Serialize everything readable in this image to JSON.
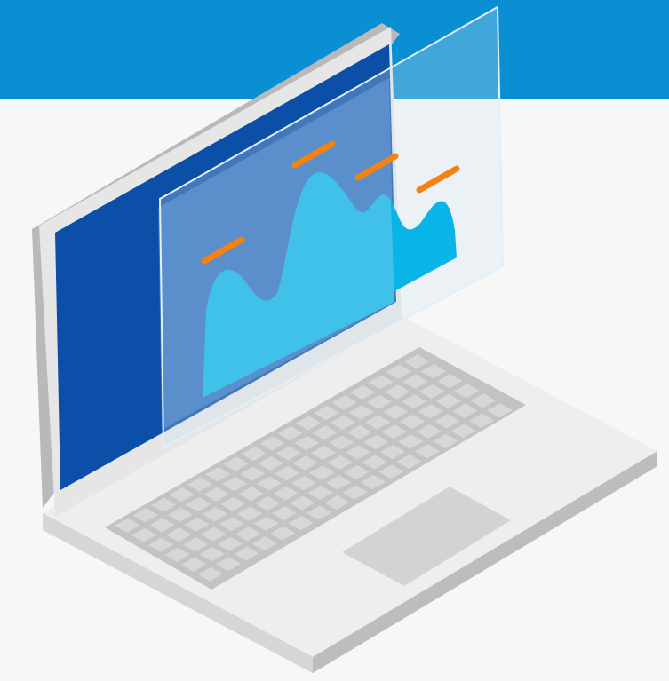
{
  "illustration": {
    "subject": "laptop-icon",
    "colors": {
      "header_band": "#0a8fd2",
      "page_background": "#f7f7f7",
      "laptop_body": "#eeeeee",
      "laptop_edge": "#c9c9c9",
      "screen_frame": "#0b4fa8",
      "screen_panel": "#2f6fbd",
      "chart_area": "#08b5e6",
      "marker": "#f5820f",
      "keyboard": "#c3c3c3",
      "key": "#d7d7d7",
      "trackpad": "#d3d3d3",
      "glass_panel": "#cfe3ef"
    },
    "chart_markers": 4,
    "keyboard_rows": 6
  }
}
